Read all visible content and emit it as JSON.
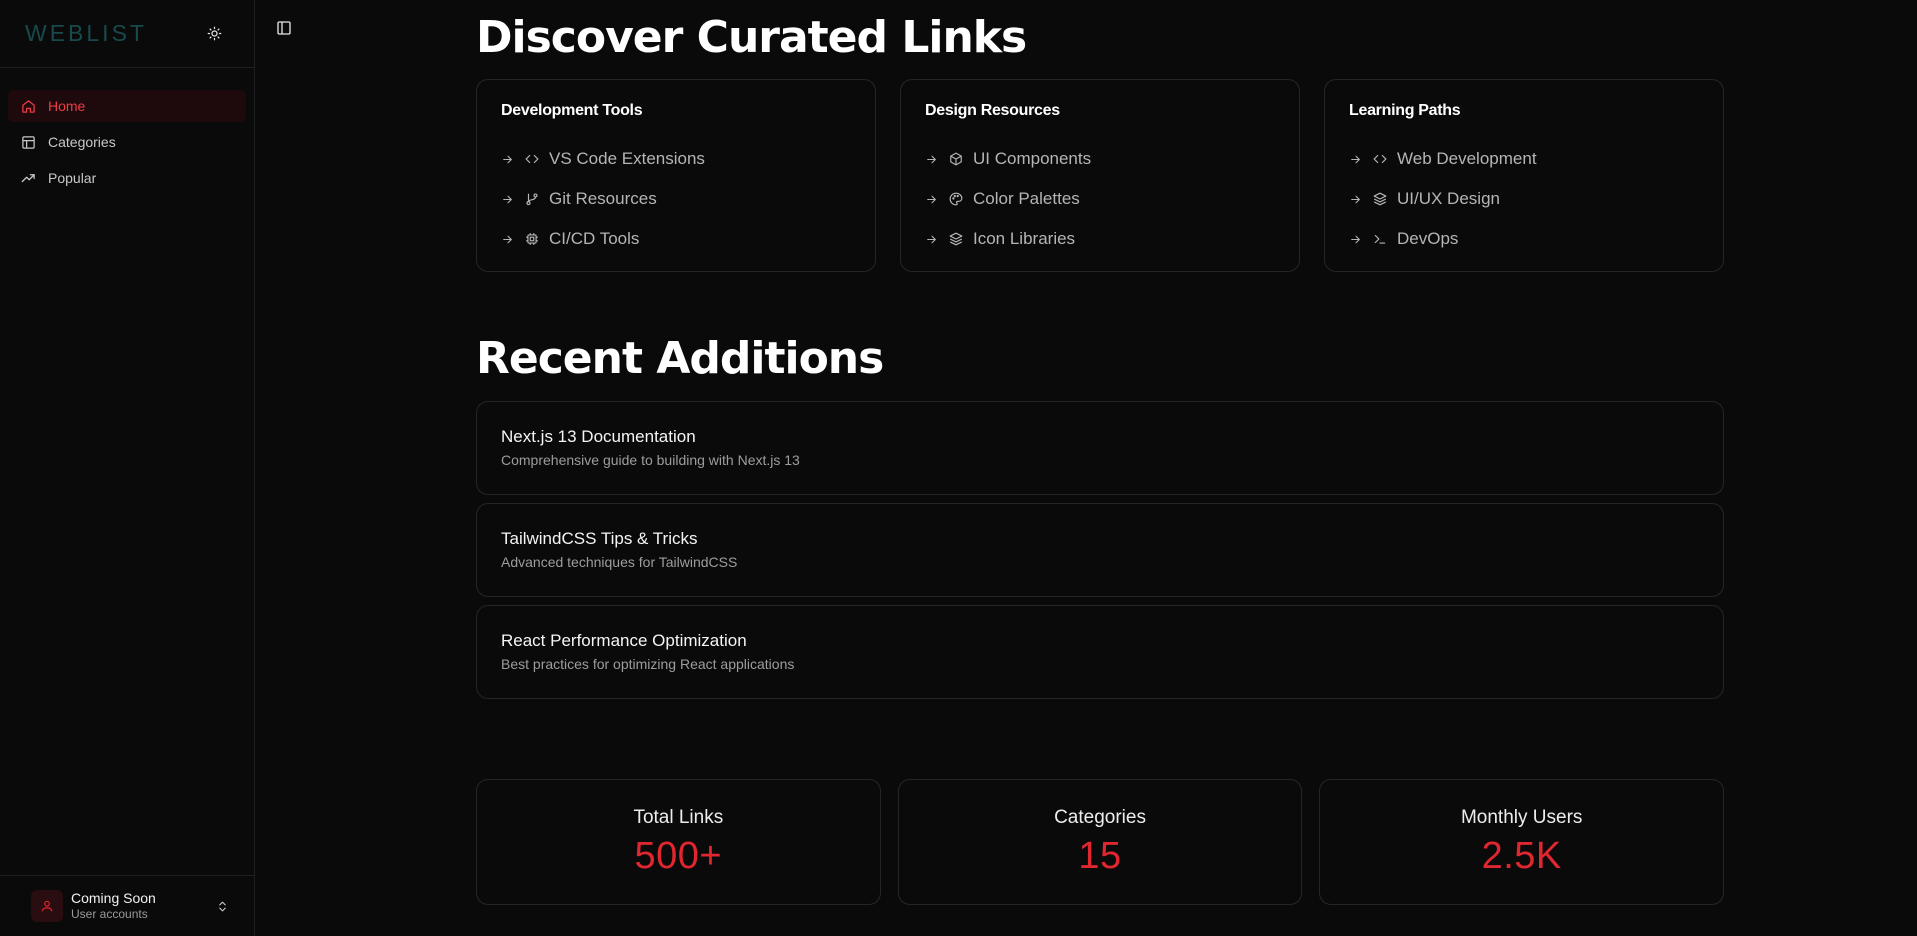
{
  "app": {
    "logo": "WEBLIST"
  },
  "sidebar": {
    "items": [
      {
        "label": "Home",
        "icon": "home-icon",
        "active": true
      },
      {
        "label": "Categories",
        "icon": "layout-icon",
        "active": false
      },
      {
        "label": "Popular",
        "icon": "trending-up-icon",
        "active": false
      }
    ],
    "user": {
      "name": "Coming Soon",
      "subtitle": "User accounts"
    }
  },
  "main": {
    "discover_title": "Discover Curated Links",
    "categories": [
      {
        "title": "Development Tools",
        "links": [
          {
            "label": "VS Code Extensions",
            "icon": "code-icon"
          },
          {
            "label": "Git Resources",
            "icon": "git-branch-icon"
          },
          {
            "label": "CI/CD Tools",
            "icon": "cpu-icon"
          }
        ]
      },
      {
        "title": "Design Resources",
        "links": [
          {
            "label": "UI Components",
            "icon": "box-icon"
          },
          {
            "label": "Color Palettes",
            "icon": "palette-icon"
          },
          {
            "label": "Icon Libraries",
            "icon": "layers-icon"
          }
        ]
      },
      {
        "title": "Learning Paths",
        "links": [
          {
            "label": "Web Development",
            "icon": "code-icon"
          },
          {
            "label": "UI/UX Design",
            "icon": "layers-icon"
          },
          {
            "label": "DevOps",
            "icon": "terminal-icon"
          }
        ]
      }
    ],
    "recent_title": "Recent Additions",
    "recent": [
      {
        "title": "Next.js 13 Documentation",
        "desc": "Comprehensive guide to building with Next.js 13"
      },
      {
        "title": "TailwindCSS Tips & Tricks",
        "desc": "Advanced techniques for TailwindCSS"
      },
      {
        "title": "React Performance Optimization",
        "desc": "Best practices for optimizing React applications"
      }
    ],
    "stats": [
      {
        "label": "Total Links",
        "value": "500+"
      },
      {
        "label": "Categories",
        "value": "15"
      },
      {
        "label": "Monthly Users",
        "value": "2.5K"
      }
    ]
  },
  "colors": {
    "accent": "#e0262f",
    "logo": "#184a4d",
    "background": "#0a0a0a",
    "border": "#262626"
  }
}
